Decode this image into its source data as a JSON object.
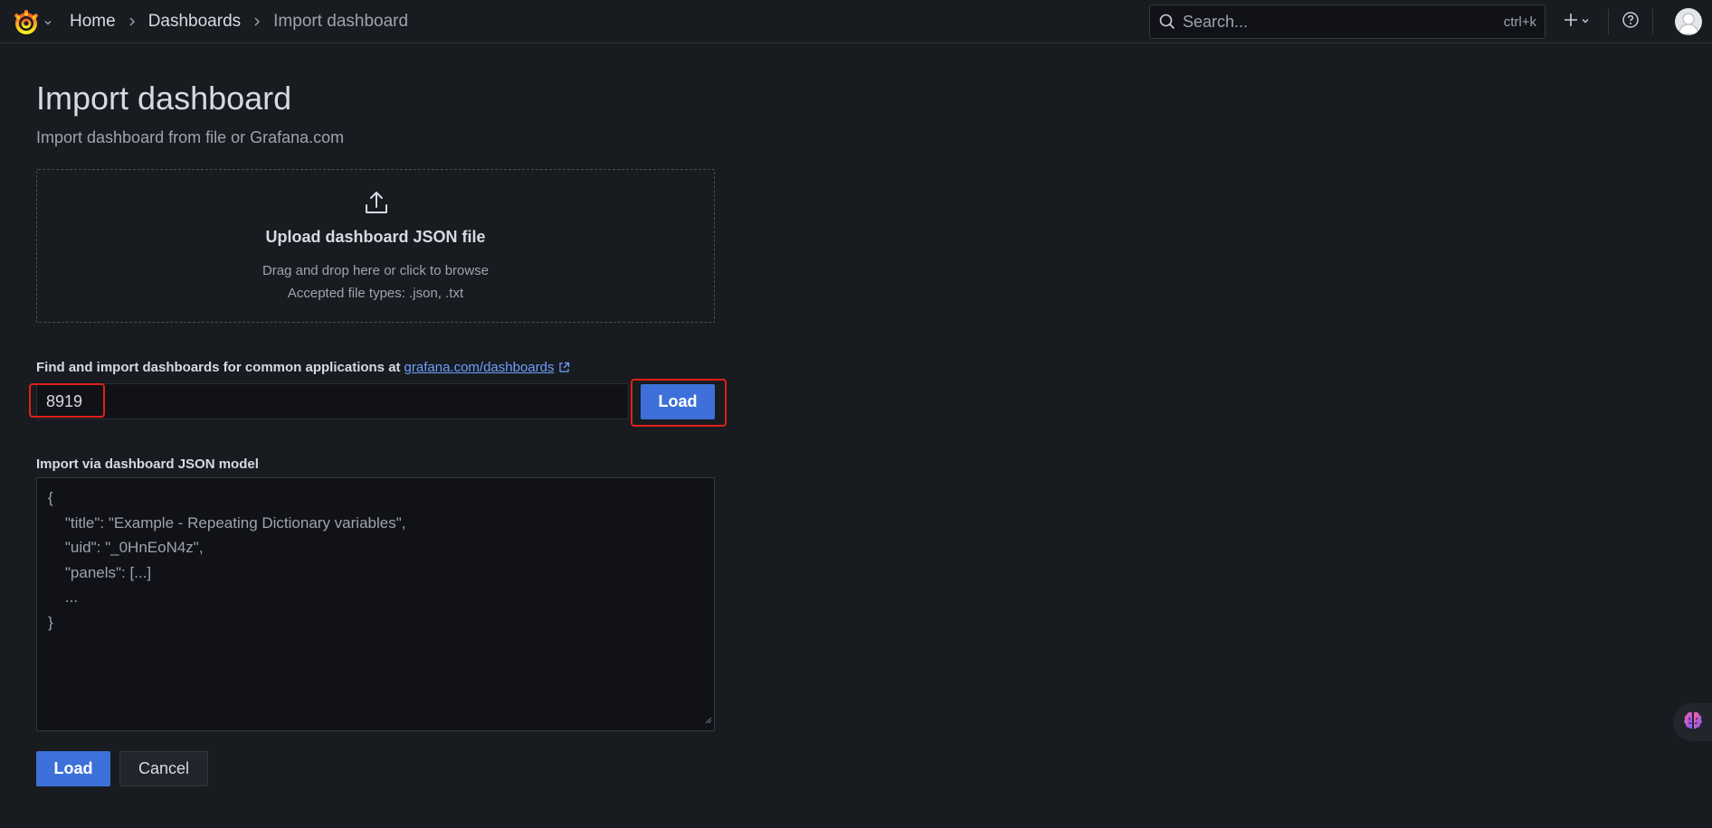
{
  "topbar": {
    "logo_icon": "grafana-logo-icon",
    "breadcrumb": {
      "home": "Home",
      "dashboards": "Dashboards",
      "current": "Import dashboard"
    },
    "search": {
      "placeholder": "Search...",
      "shortcut": "ctrl+k"
    },
    "icons": [
      "plus-icon",
      "chevron-down-icon",
      "help-icon",
      "user-avatar"
    ]
  },
  "page": {
    "title": "Import dashboard",
    "subtitle": "Import dashboard from file or Grafana.com"
  },
  "upload": {
    "icon": "upload-icon",
    "title": "Upload dashboard JSON file",
    "line1": "Drag and drop here or click to browse",
    "line2": "Accepted file types: .json, .txt"
  },
  "grafana_com": {
    "label": "Find and import dashboards for common applications at",
    "link_text": "grafana.com/dashboards",
    "input_value": "8919",
    "load_label": "Load"
  },
  "json_model": {
    "label": "Import via dashboard JSON model",
    "placeholder": "{\n    \"title\": \"Example - Repeating Dictionary variables\",\n    \"uid\": \"_0HnEoN4z\",\n    \"panels\": [...]\n    ...\n}"
  },
  "actions": {
    "load_label": "Load",
    "cancel_label": "Cancel"
  },
  "colors": {
    "background": "#181b1f",
    "primary": "#3d71d9",
    "link": "#6e9fff",
    "highlight": "#e0201a"
  }
}
